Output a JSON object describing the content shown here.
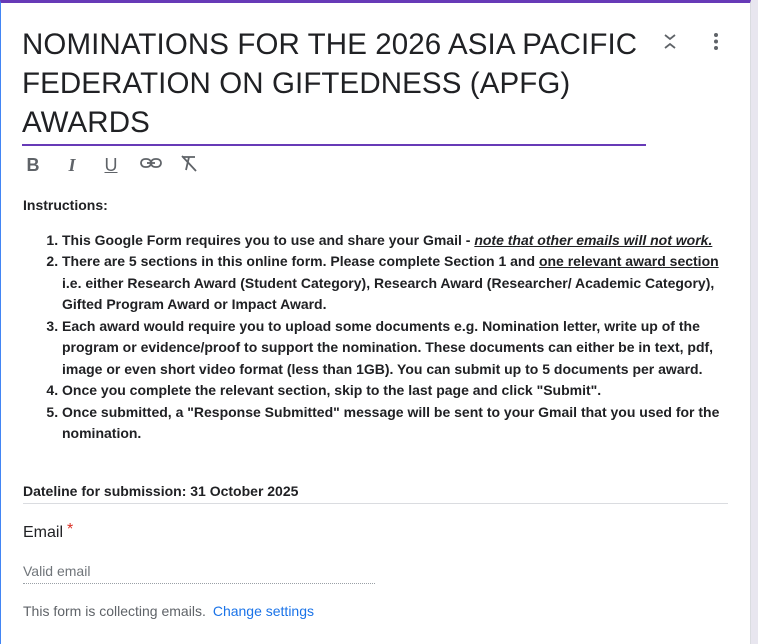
{
  "form": {
    "title": "NOMINATIONS FOR THE 2026 ASIA PACIFIC FEDERATION ON GIFTEDNESS (APFG) AWARDS"
  },
  "icons": {
    "collapse": "collapse-icon",
    "more": "more-vert-icon"
  },
  "toolbar": {
    "bold_glyph": "B",
    "italic_glyph": "I",
    "underline_glyph": "U",
    "link_glyph": "⛓",
    "clear_glyph": "T̸"
  },
  "description": {
    "heading": "Instructions:",
    "items": [
      {
        "a": "This Google Form requires you to use and share your Gmail - ",
        "b": "note that other emails will not work."
      },
      {
        "a": "There are 5 sections in this online form. Please complete Section 1 and ",
        "b": "one relevant award section ",
        "c": "i.e. either Research Award (Student Category), Research Award (Researcher/ Academic Category), Gifted Program Award or Impact Award."
      },
      {
        "a": "Each award would require you to upload some documents e.g. Nomination letter, write up of the program or evidence/proof to support the nomination. These documents can either be in text, pdf, image or even short video format (less than 1GB). You can submit up to 5 documents per award."
      },
      {
        "a": "Once you complete the relevant section, skip to the last page and click \"Submit\"."
      },
      {
        "a": "Once submitted, a \"Response Submitted\" message will be sent to your Gmail that you used for the nomination."
      }
    ],
    "deadline": "Dateline for submission: 31 October 2025"
  },
  "email": {
    "label": "Email",
    "required_mark": "*",
    "placeholder": "Valid email"
  },
  "footer": {
    "collecting_text": "This form is collecting emails.",
    "change_settings": "Change settings"
  }
}
